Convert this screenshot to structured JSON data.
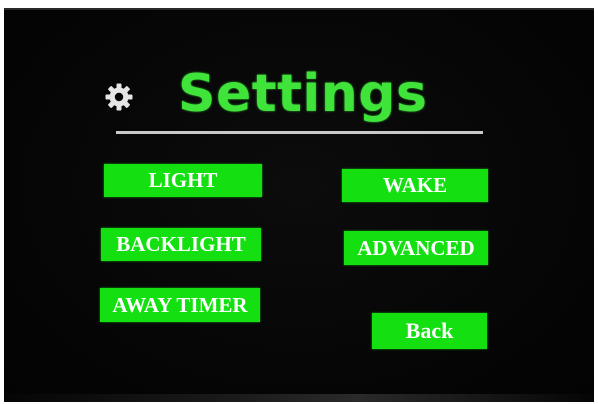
{
  "header": {
    "title": "Settings",
    "icon": "gear-icon"
  },
  "menu": {
    "light_label": "LIGHT",
    "backlight_label": "BACKLIGHT",
    "away_timer_label": "AWAY TIMER",
    "wake_label": "WAKE",
    "advanced_label": "ADVANCED",
    "back_label": "Back"
  },
  "colors": {
    "accent_green": "#3fe33a",
    "button_green": "#14e011",
    "background": "#050505",
    "divider": "#c9c9c9"
  }
}
